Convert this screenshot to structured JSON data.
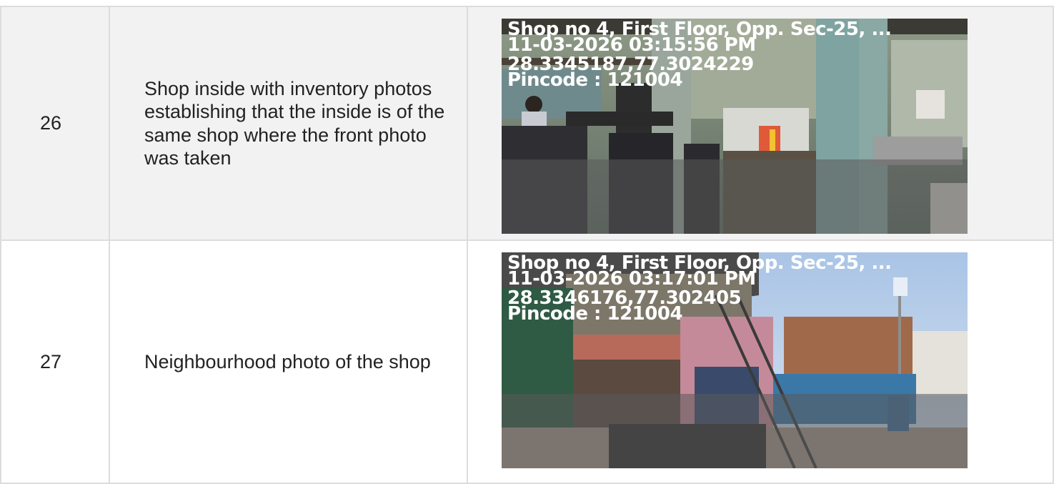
{
  "rows": [
    {
      "number": "26",
      "description": "Shop inside with inventory photos establishing that the inside is of the same shop where the front photo was taken",
      "photo": {
        "address": "Shop no 4, First Floor, Opp. Sec-25, ...",
        "datetime": "11-03-2026 03:15:56 PM",
        "coordinates": "28.3345187,77.3024229",
        "pincode": "Pincode : 121004"
      }
    },
    {
      "number": "27",
      "description": "Neighbourhood photo of the shop",
      "photo": {
        "address": "Shop no 4, First Floor, Opp. Sec-25, ...",
        "datetime": "11-03-2026 03:17:01 PM",
        "coordinates": "28.3346176,77.302405",
        "pincode": "Pincode : 121004"
      }
    }
  ]
}
